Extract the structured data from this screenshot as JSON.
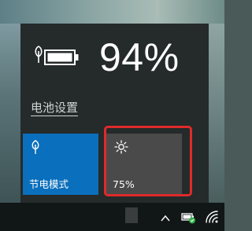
{
  "battery": {
    "percent_text": "94%",
    "level": 0.94,
    "settings_link_label": "电池设置"
  },
  "quick_actions": {
    "battery_saver": {
      "label": "节电模式",
      "icon": "leaf-icon"
    },
    "brightness": {
      "label": "75%",
      "icon": "sun-icon",
      "level": 0.75
    }
  },
  "taskbar": {
    "icons": [
      "chevron-up-icon",
      "battery-charging-icon",
      "wifi-icon"
    ]
  },
  "colors": {
    "flyout_bg": "#252a2a",
    "tile_active": "#0a6fbc",
    "tile_inactive": "#4a4a4a",
    "highlight": "#e02a2a"
  }
}
